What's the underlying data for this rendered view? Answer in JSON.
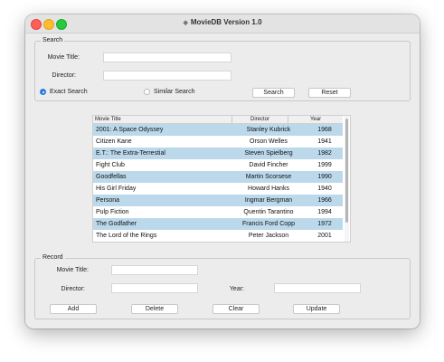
{
  "window": {
    "title": "MovieDB Version 1.0"
  },
  "search": {
    "legend": "Search",
    "movie_title_label": "Movie Title:",
    "movie_title_value": "",
    "director_label": "Director:",
    "director_value": "",
    "exact_label": "Exact Search",
    "similar_label": "Similar Search",
    "selected_mode": "Exact Search",
    "search_button": "Search",
    "reset_button": "Reset"
  },
  "table": {
    "columns": [
      "Movie Title",
      "Director",
      "Year"
    ],
    "rows": [
      [
        "2001: A Space Odyssey",
        "Stanley Kubrick",
        "1968"
      ],
      [
        "Citizen Kane",
        "Orson Welles",
        "1941"
      ],
      [
        "E.T.: The Extra-Terrestial",
        "Steven Spielberg",
        "1982"
      ],
      [
        "Fight Club",
        "David Fincher",
        "1999"
      ],
      [
        "Goodfellas",
        "Martin Scorsese",
        "1990"
      ],
      [
        "His Girl Friday",
        "Howard Hanks",
        "1940"
      ],
      [
        "Persona",
        "Ingmar Bergman",
        "1966"
      ],
      [
        "Pulp Fiction",
        "Quentin Tarantino",
        "1994"
      ],
      [
        "The Godfather",
        "Francis Ford Copp",
        "1972"
      ],
      [
        "The Lord of the Rings",
        "Peter Jackson",
        "2001"
      ]
    ]
  },
  "record": {
    "legend": "Record",
    "movie_title_label": "Movie Title:",
    "movie_title_value": "",
    "director_label": "Director:",
    "director_value": "",
    "year_label": "Year:",
    "year_value": "",
    "add_button": "Add",
    "delete_button": "Delete",
    "clear_button": "Clear",
    "update_button": "Update"
  },
  "colors": {
    "row_highlight": "#bcd9ec",
    "radio_selected": "#2a7ae2"
  }
}
